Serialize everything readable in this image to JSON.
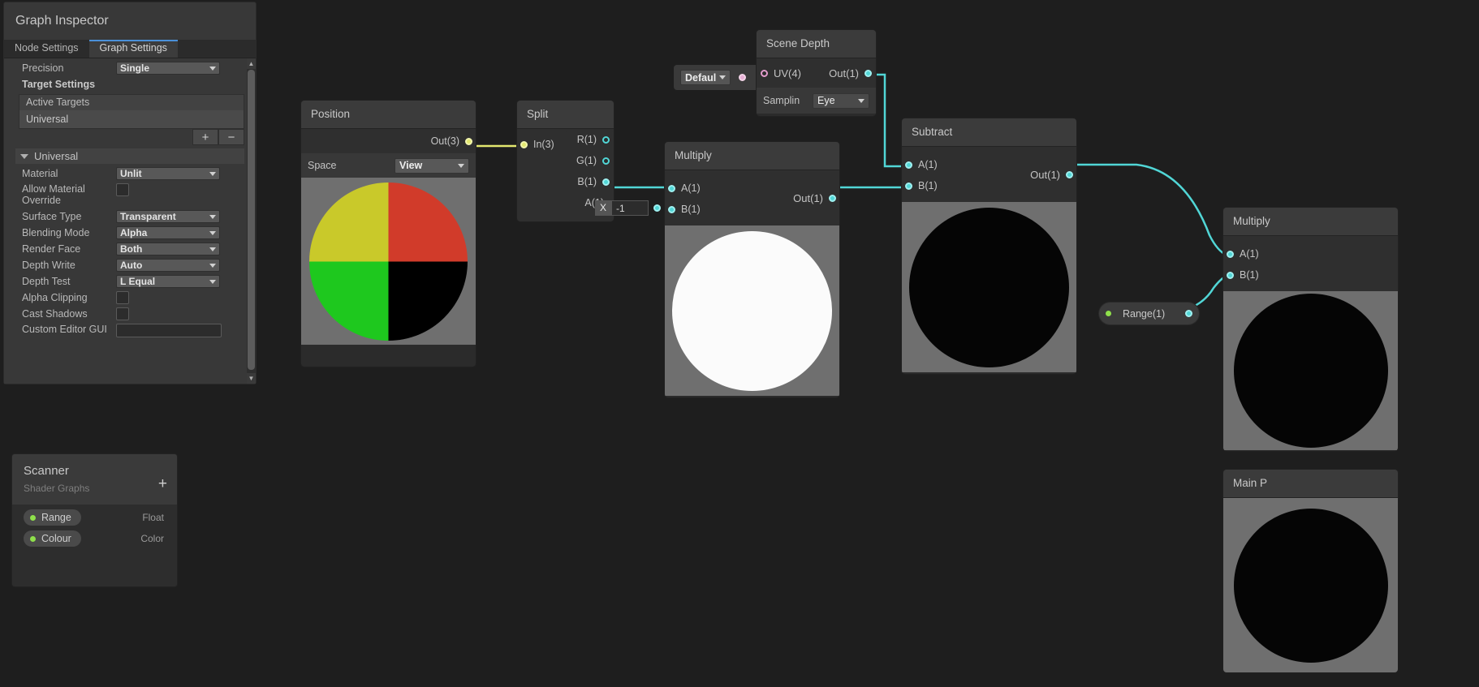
{
  "inspector": {
    "title": "Graph Inspector",
    "tabs": [
      {
        "label": "Node Settings",
        "active": false
      },
      {
        "label": "Graph Settings",
        "active": true
      }
    ],
    "precision": {
      "label": "Precision",
      "value": "Single"
    },
    "target_settings_label": "Target Settings",
    "active_targets_header": "Active Targets",
    "active_targets": [
      "Universal"
    ],
    "add_button": "+",
    "remove_button": "−",
    "foldout": {
      "label": "Universal",
      "expanded": true
    },
    "fields": [
      {
        "label": "Material",
        "type": "dropdown",
        "value": "Unlit"
      },
      {
        "label": "Allow Material Override",
        "type": "checkbox",
        "value": false
      },
      {
        "label": "Surface Type",
        "type": "dropdown",
        "value": "Transparent"
      },
      {
        "label": "Blending Mode",
        "type": "dropdown",
        "value": "Alpha"
      },
      {
        "label": "Render Face",
        "type": "dropdown",
        "value": "Both"
      },
      {
        "label": "Depth Write",
        "type": "dropdown",
        "value": "Auto"
      },
      {
        "label": "Depth Test",
        "type": "dropdown",
        "value": "L Equal"
      },
      {
        "label": "Alpha Clipping",
        "type": "checkbox",
        "value": false
      },
      {
        "label": "Cast Shadows",
        "type": "checkbox",
        "value": false
      },
      {
        "label": "Custom Editor GUI",
        "type": "text",
        "value": ""
      }
    ]
  },
  "blackboard": {
    "title": "Scanner",
    "subtitle": "Shader Graphs",
    "add_label": "+",
    "properties": [
      {
        "name": "Range",
        "type": "Float",
        "color": "#8fe04b"
      },
      {
        "name": "Colour",
        "type": "Color",
        "color": "#8fe04b"
      }
    ]
  },
  "nodes": {
    "position": {
      "title": "Position",
      "out_port": "Out(3)",
      "space_label": "Space",
      "space_value": "View"
    },
    "split": {
      "title": "Split",
      "in_port": "In(3)",
      "outputs": [
        "R(1)",
        "G(1)",
        "B(1)",
        "A(1)"
      ],
      "field_axis": "X",
      "field_value": "-1"
    },
    "scene_depth": {
      "title": "Scene Depth",
      "in_port": "UV(4)",
      "out_port": "Out(1)",
      "sampling_label": "Samplin",
      "sampling_value": "Eye",
      "uv_dropdown": "Defaul"
    },
    "multiply_1": {
      "title": "Multiply",
      "in_a": "A(1)",
      "in_b": "B(1)",
      "out_port": "Out(1)"
    },
    "subtract": {
      "title": "Subtract",
      "in_a": "A(1)",
      "in_b": "B(1)",
      "out_port": "Out(1)"
    },
    "multiply_2": {
      "title": "Multiply",
      "in_a": "A(1)",
      "in_b": "B(1)"
    },
    "range_property": {
      "label": "Range(1)"
    },
    "main_preview": {
      "title": "Main P"
    }
  },
  "colors": {
    "accent_tab": "#4a90d9",
    "wire_float": "#51d6d6",
    "wire_vector3": "#e3e86f",
    "wire_uv": "#e8aed6",
    "property_green": "#8fe04b"
  }
}
